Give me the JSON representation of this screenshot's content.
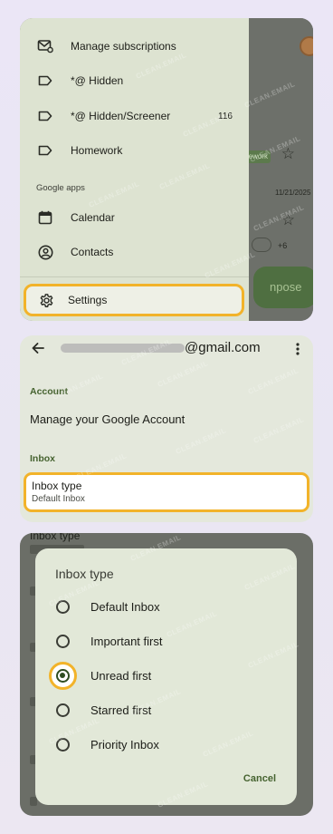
{
  "drawer": {
    "items": [
      {
        "label": "Manage subscriptions",
        "icon": "subscriptions-icon"
      },
      {
        "label": "*@ Hidden",
        "icon": "label-icon"
      },
      {
        "label": "*@ Hidden/Screener",
        "icon": "label-icon",
        "count": "116"
      },
      {
        "label": "Homework",
        "icon": "label-icon"
      }
    ],
    "section_label": "Google apps",
    "apps": [
      {
        "label": "Calendar",
        "icon": "calendar-icon"
      },
      {
        "label": "Contacts",
        "icon": "contacts-icon"
      }
    ],
    "settings_label": "Settings"
  },
  "background": {
    "chip": "ework",
    "date": "11/21/2025",
    "plus": "+6",
    "compose": "npose"
  },
  "settings": {
    "email_domain": "@gmail.com",
    "account_section": "Account",
    "manage_account": "Manage your Google Account",
    "inbox_section": "Inbox",
    "inbox_type_title": "Inbox type",
    "inbox_type_value": "Default Inbox"
  },
  "dialog": {
    "underlay_title": "Inbox type",
    "title": "Inbox type",
    "options": [
      {
        "label": "Default Inbox",
        "selected": false
      },
      {
        "label": "Important first",
        "selected": false
      },
      {
        "label": "Unread first",
        "selected": true
      },
      {
        "label": "Starred first",
        "selected": false
      },
      {
        "label": "Priority Inbox",
        "selected": false
      }
    ],
    "cancel_label": "Cancel"
  },
  "watermark": "CLEAN.EMAIL",
  "colors": {
    "highlight": "#f2b32a",
    "accent_green": "#45622f"
  }
}
